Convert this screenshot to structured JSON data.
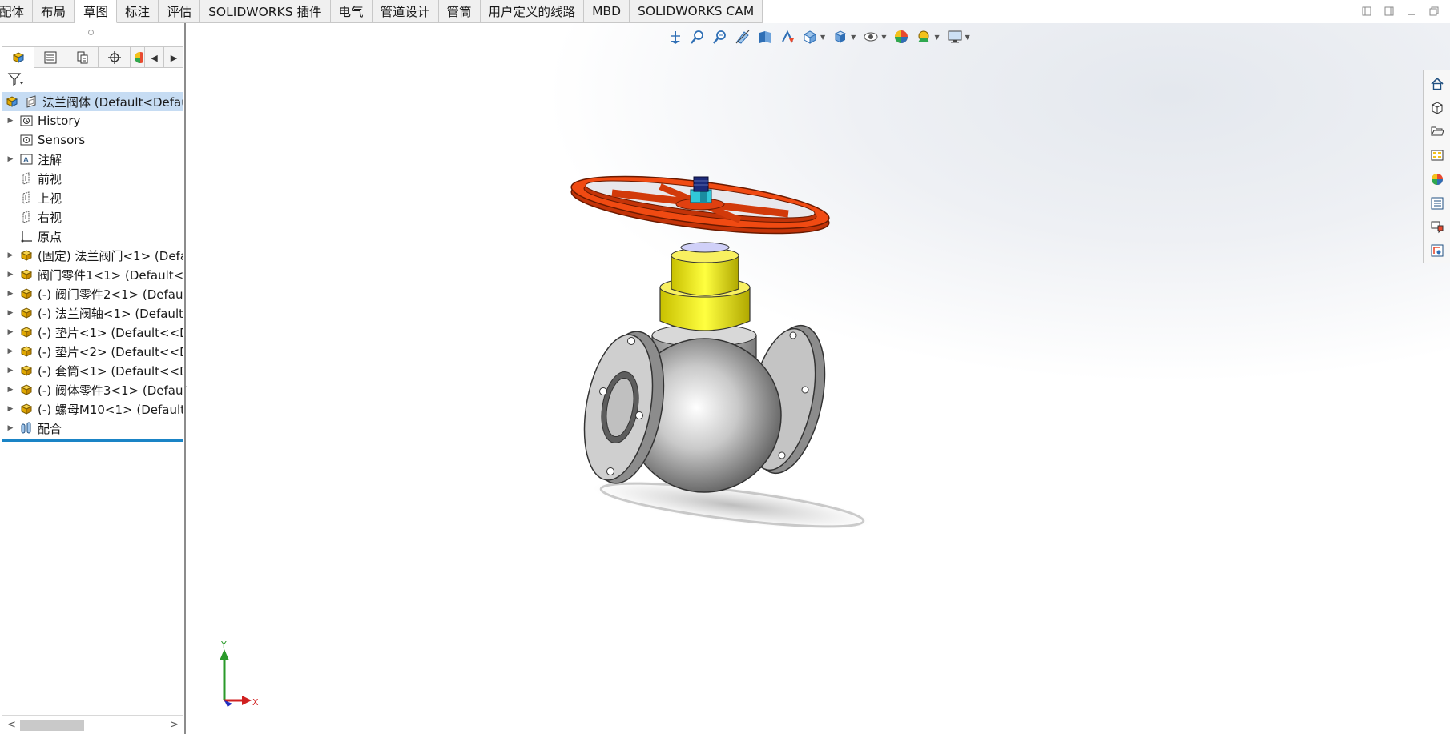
{
  "command_tabs": [
    {
      "label": "配体",
      "active": false
    },
    {
      "label": "布局",
      "active": false
    },
    {
      "label": "草图",
      "active": true
    },
    {
      "label": "标注",
      "active": false
    },
    {
      "label": "评估",
      "active": false
    },
    {
      "label": "SOLIDWORKS 插件",
      "active": false
    },
    {
      "label": "电气",
      "active": false
    },
    {
      "label": "管道设计",
      "active": false
    },
    {
      "label": "管筒",
      "active": false
    },
    {
      "label": "用户定义的线路",
      "active": false
    },
    {
      "label": "MBD",
      "active": false
    },
    {
      "label": "SOLIDWORKS CAM",
      "active": false
    }
  ],
  "feature_tree": {
    "root": "法兰阀体  (Default<Default",
    "items": [
      {
        "label": "History",
        "icon": "history-folder-icon",
        "expandable": true
      },
      {
        "label": "Sensors",
        "icon": "sensors-icon",
        "expandable": false
      },
      {
        "label": "注解",
        "icon": "annotations-icon",
        "expandable": true
      },
      {
        "label": "前视",
        "icon": "plane-icon",
        "expandable": false
      },
      {
        "label": "上视",
        "icon": "plane-icon",
        "expandable": false
      },
      {
        "label": "右视",
        "icon": "plane-icon",
        "expandable": false
      },
      {
        "label": "原点",
        "icon": "origin-icon",
        "expandable": false
      },
      {
        "label": "(固定) 法兰阀门<1> (Defa",
        "icon": "part-icon",
        "expandable": true
      },
      {
        "label": "阀门零件1<1> (Default<<",
        "icon": "part-icon",
        "expandable": true
      },
      {
        "label": "(-) 阀门零件2<1> (Default",
        "icon": "part-icon",
        "expandable": true
      },
      {
        "label": "(-) 法兰阀轴<1> (Default<",
        "icon": "part-icon",
        "expandable": true
      },
      {
        "label": "(-) 垫片<1> (Default<<De",
        "icon": "part-icon",
        "expandable": true
      },
      {
        "label": "(-) 垫片<2> (Default<<De",
        "icon": "part-icon",
        "expandable": true
      },
      {
        "label": "(-) 套筒<1> (Default<<De",
        "icon": "part-icon",
        "expandable": true
      },
      {
        "label": "(-) 阀体零件3<1> (Default",
        "icon": "part-icon",
        "expandable": true
      },
      {
        "label": "(-) 螺母M10<1> (Default<",
        "icon": "part-icon",
        "expandable": true
      },
      {
        "label": "配合",
        "icon": "mates-icon",
        "expandable": true
      }
    ]
  },
  "triad": {
    "y_label": "Y",
    "x_label": "X"
  },
  "colors": {
    "handwheel": "#e0400e",
    "stem_sleeve": "#f0e800",
    "body": "#b8b8b8",
    "selection": "#c6dcf3",
    "accent": "#1a84c6"
  }
}
